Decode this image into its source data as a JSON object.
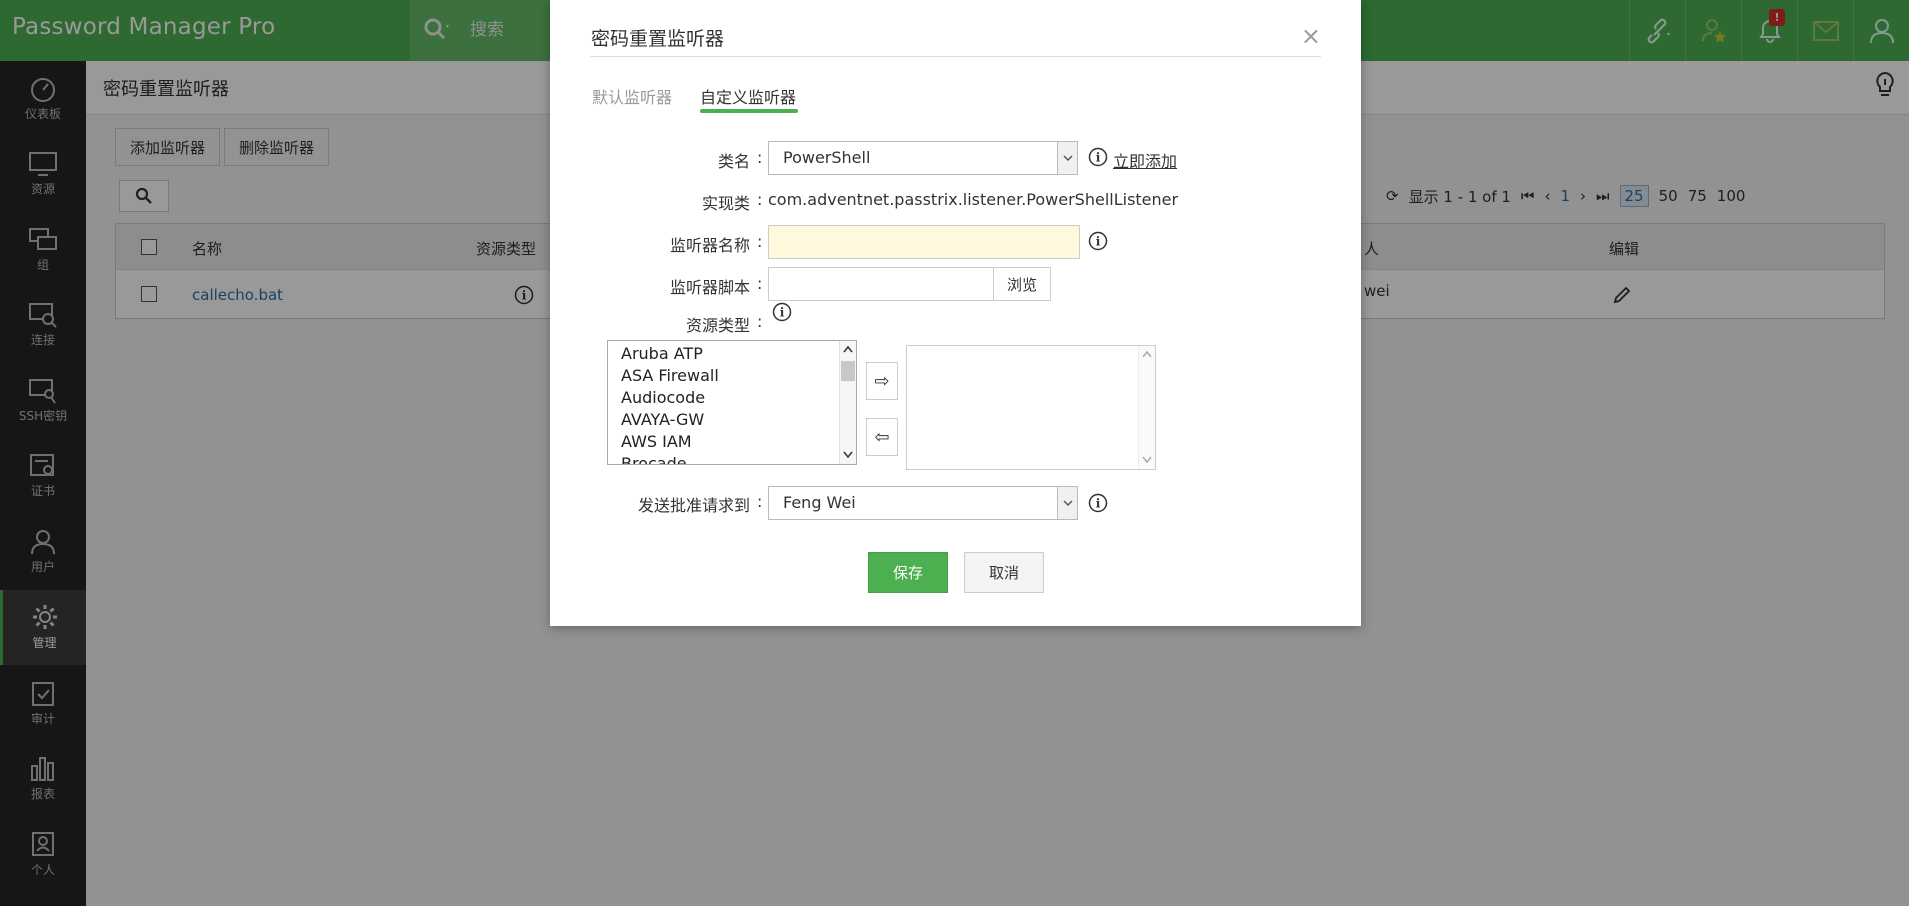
{
  "app": {
    "logo_text": "Password Manager Pro",
    "search_placeholder": "搜索",
    "notification_count": "!"
  },
  "sidebar": {
    "items": [
      {
        "label": "仪表板",
        "icon": "dashboard-icon"
      },
      {
        "label": "资源",
        "icon": "monitor-icon"
      },
      {
        "label": "组",
        "icon": "group-icon"
      },
      {
        "label": "连接",
        "icon": "connection-icon"
      },
      {
        "label": "SSH密钥",
        "icon": "ssh-key-icon"
      },
      {
        "label": "证书",
        "icon": "certificate-icon"
      },
      {
        "label": "用户",
        "icon": "user-icon"
      },
      {
        "label": "管理",
        "icon": "gear-icon"
      },
      {
        "label": "审计",
        "icon": "audit-icon"
      },
      {
        "label": "报表",
        "icon": "report-icon"
      },
      {
        "label": "个人",
        "icon": "personal-icon"
      }
    ],
    "active": "管理"
  },
  "page": {
    "title": "密码重置监听器",
    "add_button": "添加监听器",
    "delete_button": "删除监听器",
    "pager": {
      "display": "显示 1 - 1 of 1",
      "current_page": "1",
      "page_sizes": [
        "25",
        "50",
        "75",
        "100"
      ],
      "selected_size": "25"
    },
    "table": {
      "columns": [
        "名称",
        "资源类型",
        "人",
        "编辑"
      ],
      "rows": [
        {
          "name": "callecho.bat",
          "owner": "wei"
        }
      ]
    }
  },
  "modal": {
    "title": "密码重置监听器",
    "close": "×",
    "tabs": [
      "默认监听器",
      "自定义监听器"
    ],
    "active_tab": "自定义监听器",
    "fields": {
      "class_label": "类名",
      "class_value": "PowerShell",
      "add_now": "立即添加",
      "impl_label": "实现类",
      "impl_value": "com.adventnet.passtrix.listener.PowerShellListener",
      "name_label": "监听器名称",
      "name_value": "",
      "script_label": "监听器脚本",
      "browse": "浏览",
      "resource_type_label": "资源类型",
      "resource_types": [
        "Aruba ATP",
        "ASA Firewall",
        "Audiocode",
        "AVAYA-GW",
        "AWS IAM",
        "Brocade"
      ],
      "approval_label": "发送批准请求到",
      "approval_value": "Feng Wei"
    },
    "save": "保存",
    "cancel": "取消"
  },
  "colors": {
    "header_green": "#4caf50",
    "sidebar_dark": "#262626",
    "link_blue": "#2f6fa6",
    "input_highlight": "#fff8dc"
  }
}
